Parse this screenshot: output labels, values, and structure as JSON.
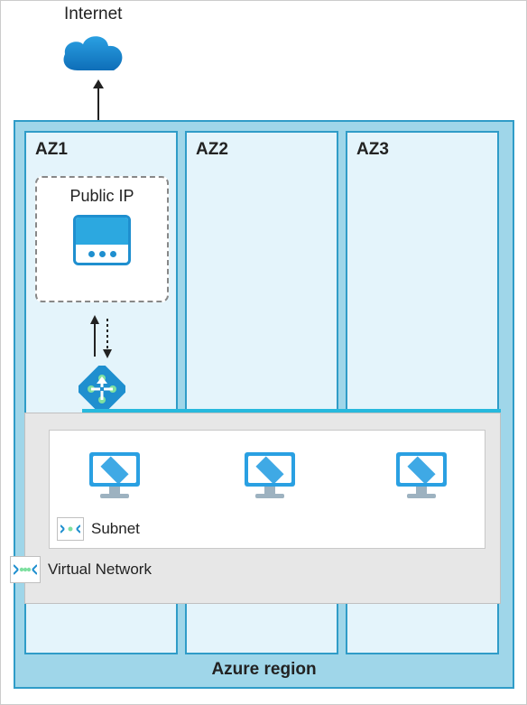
{
  "labels": {
    "internet": "Internet",
    "region": "Azure region",
    "az1": "AZ1",
    "az2": "AZ2",
    "az3": "AZ3",
    "publicIp": "Public IP",
    "subnet": "Subnet",
    "vnet": "Virtual Network"
  },
  "structure": {
    "region": "Azure region",
    "availability_zones": [
      "AZ1",
      "AZ2",
      "AZ3"
    ],
    "public_ip_zone": "AZ1",
    "load_balancer_zone": "AZ1",
    "virtual_network": {
      "subnets": [
        {
          "vms": [
            "vm-az1",
            "vm-az2",
            "vm-az3"
          ]
        }
      ]
    },
    "traffic_flow": [
      "Internet -> Public IP",
      "Public IP <-> Load Balancer",
      "Load Balancer -> Virtual Network / Subnet VMs"
    ]
  },
  "icons": {
    "cloud": "cloud-icon",
    "publicIp": "public-ip-icon",
    "loadBalancer": "load-balancer-icon",
    "vm": "vm-icon",
    "subnet": "subnet-icon",
    "vnet": "vnet-icon"
  },
  "colors": {
    "azureBlue": "#1f8fcf",
    "azureCyan": "#27b9dd",
    "regionFill": "#9fd6e9",
    "zoneFill": "#e4f4fb",
    "gray": "#e7e7e7"
  }
}
